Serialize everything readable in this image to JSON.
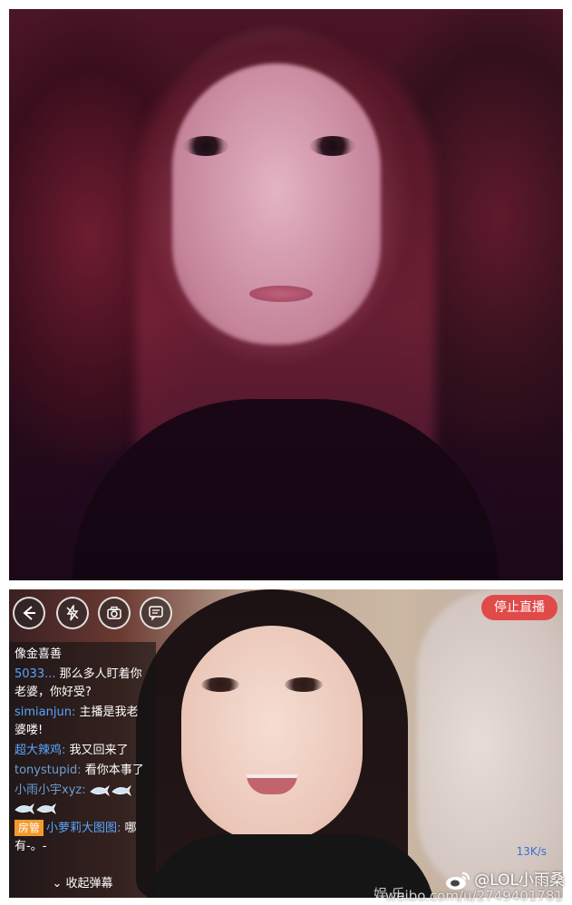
{
  "toolbar": {
    "back_icon": "back-arrow-icon",
    "flash_icon": "flash-off-icon",
    "camera_icon": "camera-switch-icon",
    "danmaku_icon": "danmaku-icon",
    "stop_label": "停止直播"
  },
  "chat": {
    "messages": [
      {
        "text": "像金喜善"
      },
      {
        "user": "5033...",
        "text": "那么多人盯着你老婆，你好受?"
      },
      {
        "user": "simianjun:",
        "text": "主播是我老婆喽!"
      },
      {
        "user": "超大辣鸡:",
        "text": "我又回来了"
      },
      {
        "user": "tonystupid:",
        "text": "看你本事了"
      },
      {
        "user": "小雨小宇xyz:",
        "text": ""
      },
      {
        "badge": "房管",
        "user": "小萝莉大图图:",
        "text": "哪有-。-"
      }
    ],
    "collapse_label": "收起弹幕",
    "collapse_icon": "chevron-down-icon"
  },
  "stream": {
    "speed": "13K/s"
  },
  "watermark": {
    "weibo": "@LOL小雨桑",
    "url": "weibo.com/u/2749401781",
    "yule": "娱 乐"
  },
  "colors": {
    "stop_button": "#e04a48",
    "chat_user": "#58a6ff",
    "admin_badge": "#f39a2d"
  }
}
